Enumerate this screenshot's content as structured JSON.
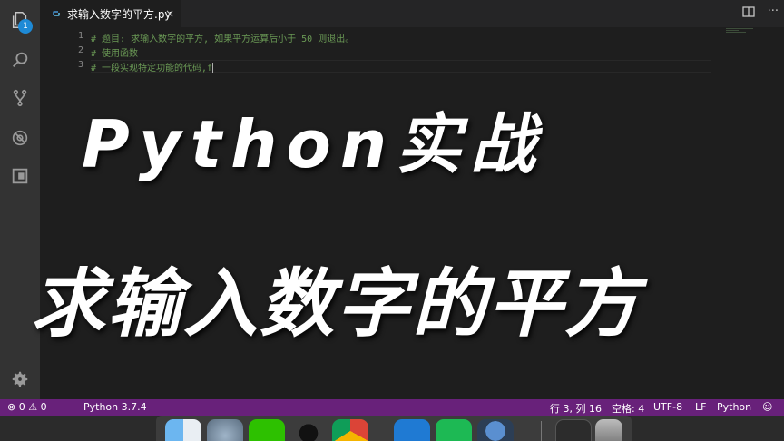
{
  "activity_bar": {
    "explorer_badge": "1",
    "icons": [
      "files-icon",
      "search-icon",
      "source-control-icon",
      "debug-icon",
      "extensions-icon",
      "gear-icon"
    ]
  },
  "tab": {
    "label": "求输入数字的平方.py",
    "close": "×"
  },
  "editor": {
    "lines": [
      {
        "num": "1",
        "text": "# 题目: 求输入数字的平方, 如果平方运算后小于 50 则退出。"
      },
      {
        "num": "2",
        "text": "# 使用函数"
      },
      {
        "num": "3",
        "text": "# 一段实现特定功能的代码,f"
      }
    ]
  },
  "overlay": {
    "title_line1": "Python实战",
    "title_line2": "求输入数字的平方"
  },
  "statusbar": {
    "errors": "0",
    "warnings": "0",
    "interpreter": "Python 3.7.4",
    "cursor_position": "行 3, 列 16",
    "indentation": "空格: 4",
    "encoding": "UTF-8",
    "line_ending": "LF",
    "language": "Python"
  },
  "colors": {
    "statusbar": "#68217a",
    "activity_bar": "#333333",
    "editor_bg": "#1e1e1e",
    "comment": "#6a9955"
  }
}
